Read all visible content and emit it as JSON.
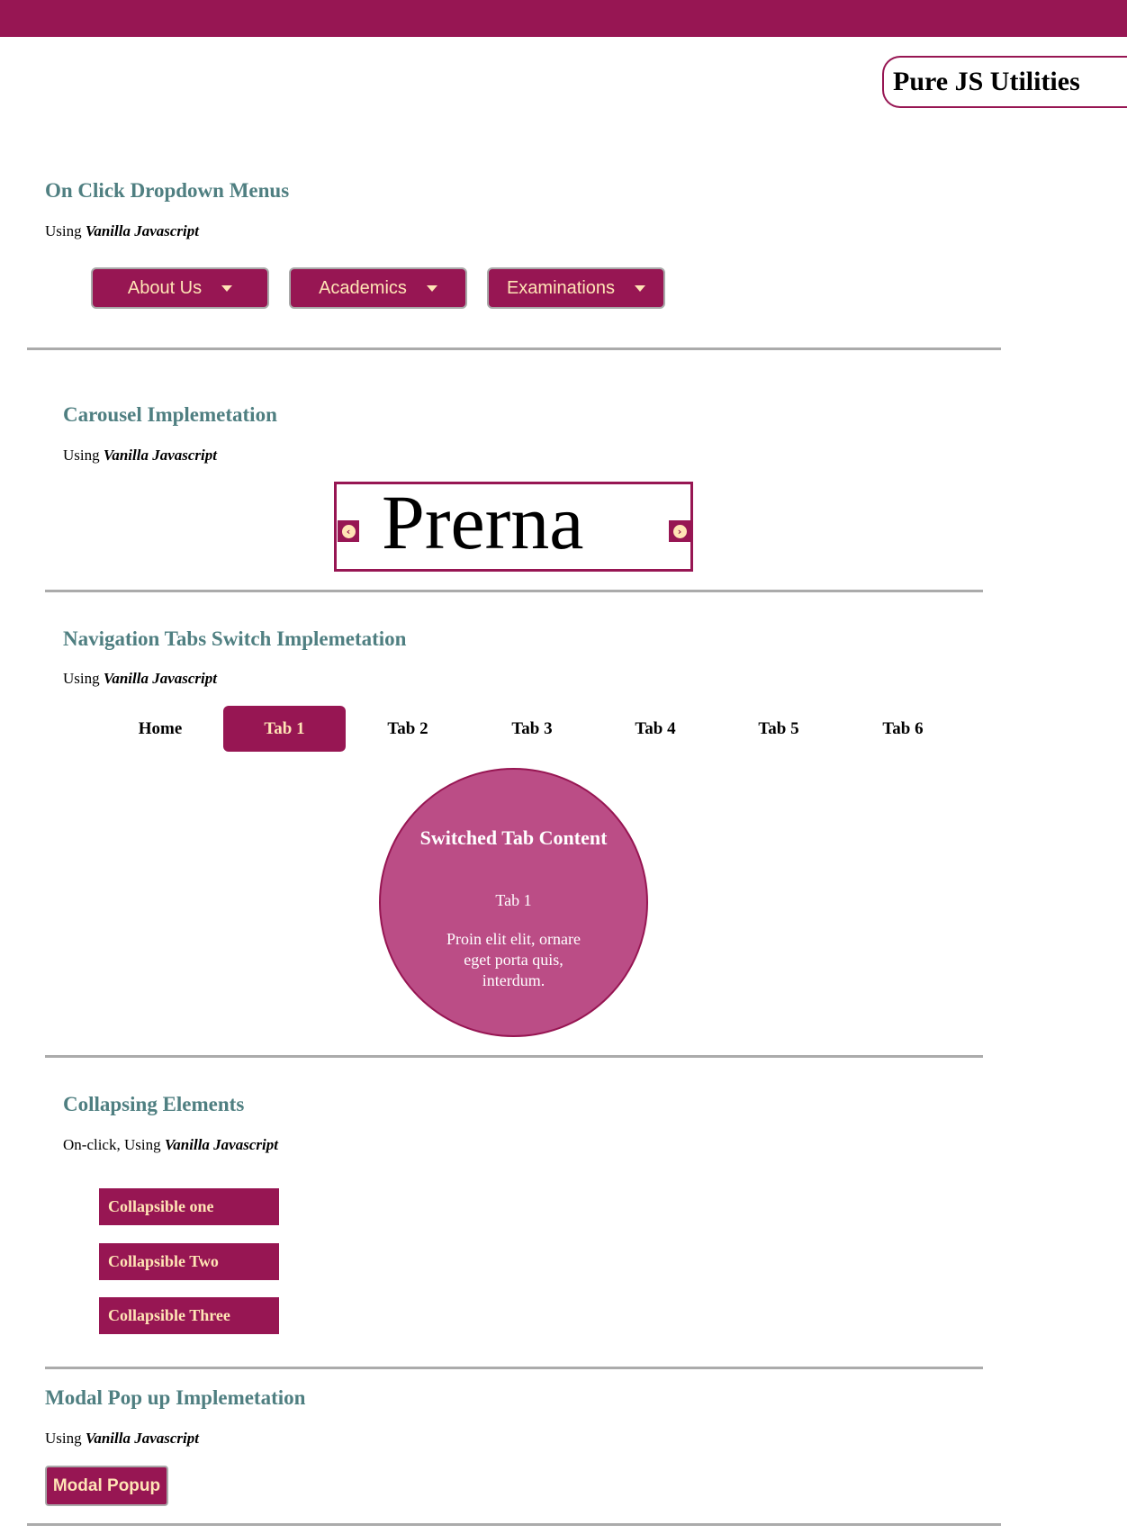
{
  "brand": "Pure JS Utilities",
  "dropdown_section": {
    "title": "On Click Dropdown Menus",
    "sub_prefix": "Using",
    "sub_em": "Vanilla Javascript",
    "buttons": [
      "About Us",
      "Academics",
      "Examinations"
    ]
  },
  "carousel_section": {
    "title": "Carousel Implemetation",
    "sub_prefix": "Using",
    "sub_em": "Vanilla Javascript",
    "slide_text": "Prerna",
    "prev_icon": "‹",
    "next_icon": "›"
  },
  "tabs_section": {
    "title": "Navigation Tabs Switch Implemetation",
    "sub_prefix": "Using",
    "sub_em": "Vanilla Javascript",
    "tabs": [
      "Home",
      "Tab 1",
      "Tab 2",
      "Tab 3",
      "Tab 4",
      "Tab 5",
      "Tab 6"
    ],
    "active_tab": "Tab 1",
    "content_title": "Switched Tab Content",
    "content_tab": "Tab 1",
    "content_body": "Proin elit elit, ornare eget porta quis, interdum."
  },
  "collapse_section": {
    "title": "Collapsing Elements",
    "sub_prefix": "On-click, Using",
    "sub_em": "Vanilla Javascript",
    "items": [
      "Collapsible one",
      "Collapsible Two",
      "Collapsible Three"
    ]
  },
  "modal_section": {
    "title": "Modal Pop up Implemetation",
    "sub_prefix": "Using",
    "sub_em": "Vanilla Javascript",
    "button": "Modal Popup"
  },
  "colors": {
    "primary": "#971653",
    "accent_text": "#ffe4b5",
    "heading": "#4f7f81",
    "circle": "#bb4d86"
  }
}
